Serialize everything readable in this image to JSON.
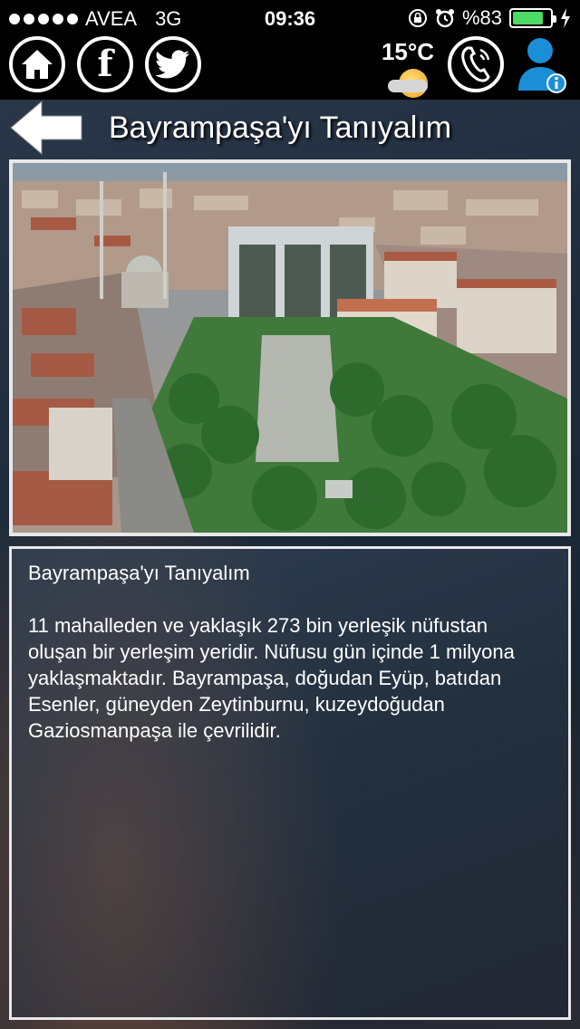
{
  "status_bar": {
    "carrier": "AVEA",
    "network": "3G",
    "time": "09:36",
    "battery_text": "%83",
    "battery_level_pct": 83,
    "signal_bars": 5
  },
  "top_bar": {
    "temperature": "15°C",
    "icons": [
      "home-icon",
      "facebook-icon",
      "twitter-icon",
      "weather-icon",
      "phone-icon",
      "user-info-icon"
    ]
  },
  "header": {
    "title": "Bayrampaşa'yı Tanıyalım"
  },
  "content": {
    "heading": "Bayrampaşa'yı Tanıyalım",
    "body": "11 mahalleden ve yaklaşık 273 bin yerleşik nüfustan oluşan bir yerleşim yeridir. Nüfusu gün içinde 1 milyona yaklaşmaktadır. Bayrampaşa, doğudan Eyüp, batıdan Esenler, güneyden Zeytinburnu, kuzeydoğudan Gaziosmanpaşa ile çevrilidir."
  },
  "colors": {
    "status_bar_bg": "#000000",
    "battery_green": "#4cd964",
    "user_icon_blue": "#1a8fd8",
    "panel_border": "#e8e8e8"
  }
}
